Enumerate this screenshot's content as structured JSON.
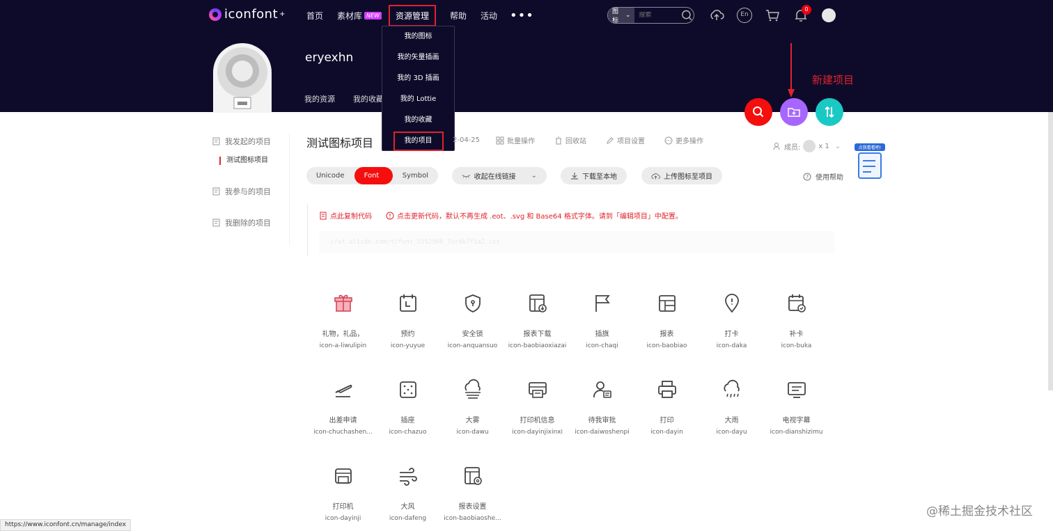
{
  "logo": {
    "text": "iconfont",
    "sup": "+"
  },
  "nav": {
    "home": "首页",
    "materials": "素材库",
    "new_badge": "NEW",
    "resources": "资源管理",
    "help": "帮助",
    "events": "活动",
    "more": "•••"
  },
  "dropdown": [
    "我的图标",
    "我的矢量插画",
    "我的 3D 插画",
    "我的 Lottie",
    "我的收藏",
    "我的项目"
  ],
  "search": {
    "type": "图标",
    "placeholder": "搜索"
  },
  "header_icons": {
    "lang": "En",
    "bell_count": "0"
  },
  "profile": {
    "username": "eryexhn",
    "tabs": [
      "我的资源",
      "我的收藏"
    ]
  },
  "annotation": "新建项目",
  "sidebar": {
    "initiated": "我发起的项目",
    "current_project": "测试图标项目",
    "joined": "我参与的项目",
    "deleted": "我删除的项目"
  },
  "project": {
    "title": "测试图标项目",
    "date": "2-04-25",
    "actions": [
      "批量操作",
      "回收站",
      "项目设置",
      "更多操作"
    ],
    "members_label": "成员:",
    "members_count": "x 1"
  },
  "tabs": {
    "unicode": "Unicode",
    "font_class": "Font class",
    "symbol": "Symbol"
  },
  "buttons": {
    "collapse": "收起在线链接",
    "download": "下载至本地",
    "upload": "上传图标至项目",
    "help": "使用帮助"
  },
  "float_card": "点我看看吧!",
  "code": {
    "copy": "点此复制代码",
    "warning": "点击更新代码，默认不再生成 .eot、.svg 和 Base64 格式字体。请到「编辑项目」中配置。",
    "line": "//at.alicdn.com/t/font_3352560_7ordk7f1a2.css"
  },
  "icons": [
    {
      "cn": "礼物，礼品，",
      "en": "icon-a-liwulipin",
      "glyph": "gift-icon"
    },
    {
      "cn": "预约",
      "en": "icon-yuyue",
      "glyph": "calendar-icon"
    },
    {
      "cn": "安全锁",
      "en": "icon-anquansuo",
      "glyph": "shield-icon"
    },
    {
      "cn": "报表下载",
      "en": "icon-baobiaoxiazai",
      "glyph": "report-download-icon"
    },
    {
      "cn": "插旗",
      "en": "icon-chaqi",
      "glyph": "flag-icon"
    },
    {
      "cn": "报表",
      "en": "icon-baobiao",
      "glyph": "report-icon"
    },
    {
      "cn": "打卡",
      "en": "icon-daka",
      "glyph": "location-icon"
    },
    {
      "cn": "补卡",
      "en": "icon-buka",
      "glyph": "calendar-check-icon"
    },
    {
      "cn": "出差申请",
      "en": "icon-chuchashen...",
      "glyph": "plane-icon"
    },
    {
      "cn": "插座",
      "en": "icon-chazuo",
      "glyph": "socket-icon"
    },
    {
      "cn": "大雾",
      "en": "icon-dawu",
      "glyph": "fog-icon"
    },
    {
      "cn": "打印机信息",
      "en": "icon-dayinjixinxi",
      "glyph": "printer-info-icon"
    },
    {
      "cn": "待我审批",
      "en": "icon-daiwoshenpi",
      "glyph": "user-approve-icon"
    },
    {
      "cn": "打印",
      "en": "icon-dayin",
      "glyph": "print-icon"
    },
    {
      "cn": "大雨",
      "en": "icon-dayu",
      "glyph": "rain-icon"
    },
    {
      "cn": "电视字幕",
      "en": "icon-dianshizimu",
      "glyph": "tv-subtitle-icon"
    },
    {
      "cn": "打印机",
      "en": "icon-dayinji",
      "glyph": "printer-icon"
    },
    {
      "cn": "大风",
      "en": "icon-dafeng",
      "glyph": "wind-icon"
    },
    {
      "cn": "报表设置",
      "en": "icon-baobiaoshe...",
      "glyph": "report-settings-icon"
    }
  ],
  "status_url": "https://www.iconfont.cn/manage/index",
  "watermark": "@稀土掘金技术社区",
  "colors": {
    "header": "#0e0b2a",
    "accent": "#f50e0e",
    "purple": "#a766ff",
    "teal": "#1bc9c4",
    "annotation": "#e0232c"
  }
}
